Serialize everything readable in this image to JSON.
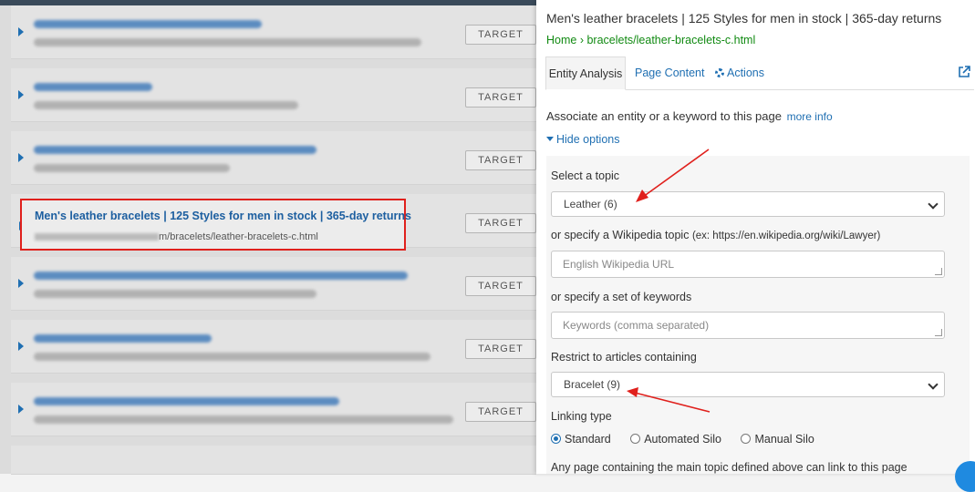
{
  "left": {
    "target_label": "TARGET",
    "highlighted": {
      "title": "Men's leather bracelets | 125 Styles for men in stock | 365-day returns",
      "url_suffix": "m/bracelets/leather-bracelets-c.html"
    }
  },
  "panel": {
    "title": "Men's leather bracelets | 125 Styles for men in stock | 365-day returns",
    "breadcrumb": "Home › bracelets/leather-bracelets-c.html",
    "tabs": {
      "entity": "Entity Analysis",
      "content": "Page Content",
      "actions": "Actions"
    },
    "associate_text": "Associate an entity or a keyword to this page",
    "more_info": "more info",
    "hide_options": "Hide options",
    "select_topic_label": "Select a topic",
    "topic_value": "Leather (6)",
    "wiki_label": "or specify a Wikipedia topic",
    "wiki_example": "(ex: https://en.wikipedia.org/wiki/Lawyer)",
    "wiki_placeholder": "English Wikipedia URL",
    "keywords_label": "or specify a set of keywords",
    "keywords_placeholder": "Keywords (comma separated)",
    "restrict_label": "Restrict to articles containing",
    "restrict_value": "Bracelet (9)",
    "linking_label": "Linking type",
    "linking_options": [
      "Standard",
      "Automated Silo",
      "Manual Silo"
    ],
    "description": "Any page containing the main topic defined above can link to this page"
  },
  "colors": {
    "link": "#1f6fb2",
    "breadcrumb": "#118a12",
    "annotation": "#e0201c"
  }
}
